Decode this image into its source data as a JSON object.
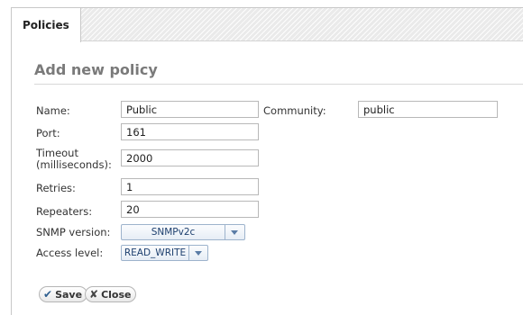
{
  "tabs": [
    {
      "label": "Policies",
      "active": true
    }
  ],
  "section": {
    "title": "Add new policy"
  },
  "form": {
    "name": {
      "label": "Name:",
      "value": "Public"
    },
    "community": {
      "label": "Community:",
      "value": "public"
    },
    "port": {
      "label": "Port:",
      "value": "161"
    },
    "timeout": {
      "label_line1": "Timeout",
      "label_line2": "(milliseconds):",
      "value": "2000"
    },
    "retries": {
      "label": "Retries:",
      "value": "1"
    },
    "repeaters": {
      "label": "Repeaters:",
      "value": "20"
    },
    "snmp_version": {
      "label": "SNMP version:",
      "value": "SNMPv2c"
    },
    "access_level": {
      "label": "Access level:",
      "value": "READ_WRITE"
    }
  },
  "buttons": {
    "save": {
      "label": "Save",
      "icon": "check-icon"
    },
    "close": {
      "label": "Close",
      "icon": "x-icon"
    }
  },
  "colors": {
    "accent": "#5a7ca6",
    "title_gray": "#7a7a7a"
  }
}
